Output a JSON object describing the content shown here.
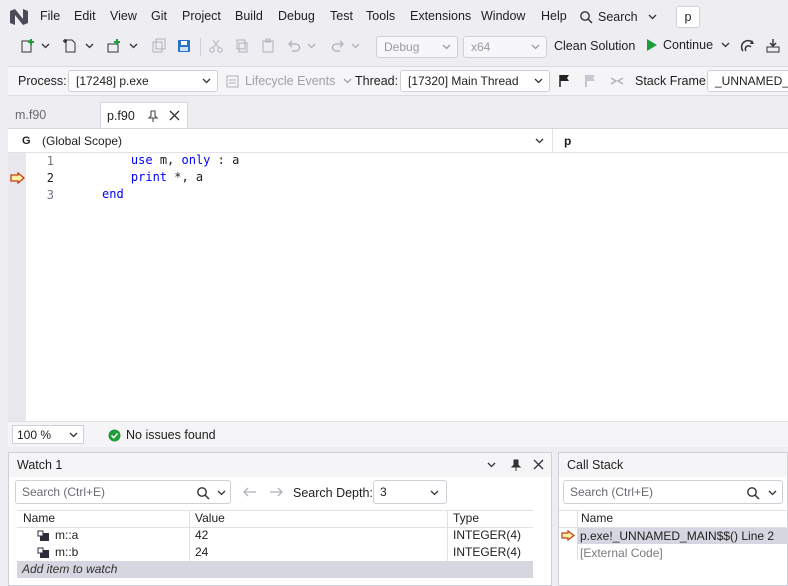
{
  "menubar": {
    "items": [
      "File",
      "Edit",
      "View",
      "Git",
      "Project",
      "Build",
      "Debug",
      "Test",
      "Tools",
      "Extensions",
      "Window",
      "Help"
    ],
    "search_label": "Search",
    "solution_name": "p"
  },
  "toolbar": {
    "config": "Debug",
    "platform": "x64",
    "clean_solution": "Clean Solution",
    "continue": "Continue"
  },
  "debugbar": {
    "process_label": "Process:",
    "process_value": "[17248] p.exe",
    "lifecycle_events": "Lifecycle Events",
    "thread_label": "Thread:",
    "thread_value": "[17320] Main Thread",
    "stack_frame_label": "Stack Frame:",
    "stack_frame_value": "_UNNAMED_M"
  },
  "tabs": [
    {
      "label": "m.f90",
      "active": false
    },
    {
      "label": "p.f90",
      "active": true
    }
  ],
  "editor": {
    "scope_left": "(Global Scope)",
    "scope_right": "p",
    "lines": [
      {
        "num": "1",
        "indent": "    ",
        "kw1": "use",
        "mid": " m, ",
        "kw2": "only",
        "tail": " : a"
      },
      {
        "num": "2",
        "indent": "    ",
        "kw1": "print",
        "mid": " *, a",
        "kw2": "",
        "tail": ""
      },
      {
        "num": "3",
        "indent": "",
        "kw1": "end",
        "mid": "",
        "kw2": "",
        "tail": ""
      }
    ],
    "current_line": 2,
    "zoom": "100 %",
    "issues": "No issues found"
  },
  "watch": {
    "title": "Watch 1",
    "search_placeholder": "Search (Ctrl+E)",
    "search_depth_label": "Search Depth:",
    "search_depth_value": "3",
    "columns": [
      "Name",
      "Value",
      "Type"
    ],
    "rows": [
      {
        "name": "m::a",
        "value": "42",
        "type": "INTEGER(4)"
      },
      {
        "name": "m::b",
        "value": "24",
        "type": "INTEGER(4)"
      }
    ],
    "add_item": "Add item to watch"
  },
  "callstack": {
    "title": "Call Stack",
    "search_placeholder": "Search (Ctrl+E)",
    "column": "Name",
    "rows": [
      "p.exe!_UNNAMED_MAIN$$() Line 2",
      "[External Code]"
    ]
  },
  "colors": {
    "accent_blue": "#0000ff",
    "continue_green": "#1e9e3a",
    "selected_row": "#cbe4f7",
    "arrow_fill": "#fff2a8",
    "arrow_stroke": "#c04010",
    "success_green": "#1f9d3a"
  }
}
